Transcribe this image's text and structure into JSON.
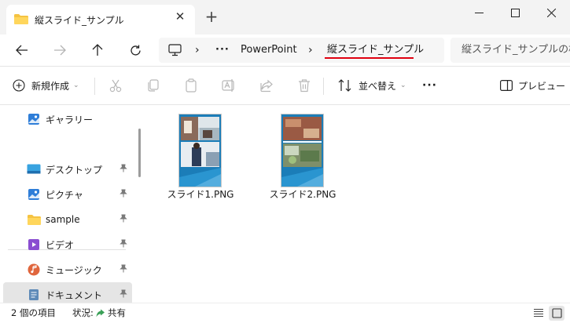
{
  "window": {
    "tab_title": "縦スライド_サンプル",
    "tab_close_icon": "close-icon",
    "new_tab_icon": "plus-icon"
  },
  "nav": {
    "breadcrumb": [
      "PowerPoint",
      "縦スライド_サンプル"
    ],
    "overflow": "···",
    "search_placeholder": "縦スライド_サンプルの検索"
  },
  "toolbar": {
    "new_label": "新規作成",
    "sort_label": "並べ替え",
    "more_label": "···",
    "preview_label": "プレビュー"
  },
  "sidebar": {
    "items": [
      {
        "label": "ギャラリー",
        "icon": "gallery-icon",
        "pinned": false
      },
      {
        "label": "デスクトップ",
        "icon": "desktop-icon",
        "pinned": true
      },
      {
        "label": "ピクチャ",
        "icon": "pictures-icon",
        "pinned": true
      },
      {
        "label": "sample",
        "icon": "folder-icon",
        "pinned": true
      },
      {
        "label": "ビデオ",
        "icon": "video-icon",
        "pinned": true
      },
      {
        "label": "ミュージック",
        "icon": "music-icon",
        "pinned": true
      },
      {
        "label": "ドキュメント",
        "icon": "documents-icon",
        "pinned": true
      }
    ],
    "pin_glyph": "📌"
  },
  "files": [
    {
      "name": "スライド1.PNG",
      "thumbnail": "slide1-thumbnail"
    },
    {
      "name": "スライド2.PNG",
      "thumbnail": "slide2-thumbnail"
    }
  ],
  "status": {
    "item_count": "2 個の項目",
    "state_label": "状況:",
    "share_label": "共有"
  },
  "colors": {
    "accent_underline": "#e0000f",
    "folder": "#f5c342",
    "selected_bg": "#e5e5e5"
  }
}
